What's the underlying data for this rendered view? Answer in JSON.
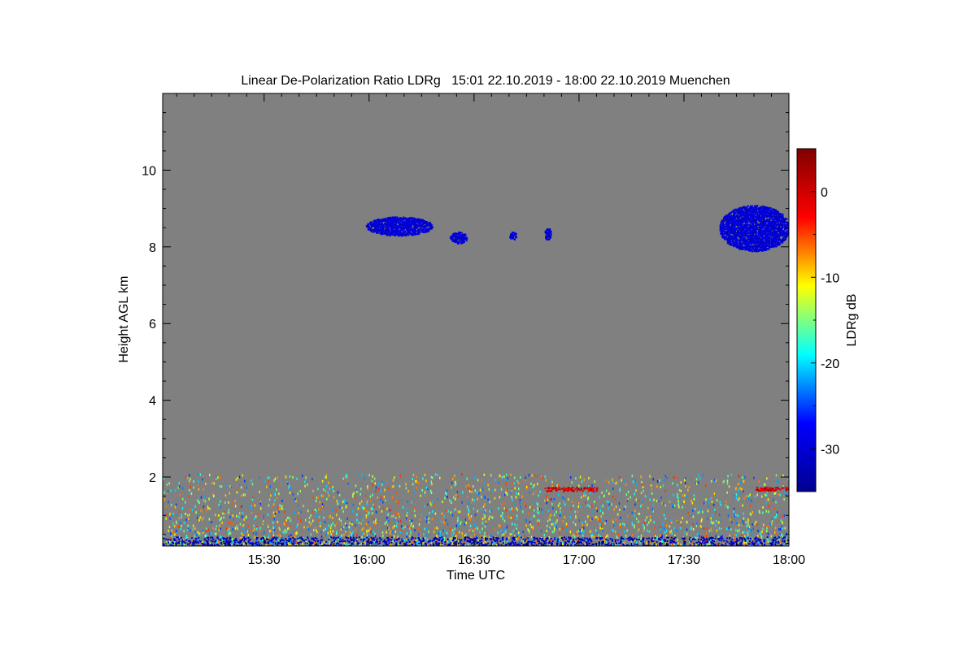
{
  "chart_data": {
    "type": "heatmap",
    "title": "Linear De-Polarization Ratio LDRg   15:01 22.10.2019 - 18:00 22.10.2019 Muenchen",
    "xlabel": "Time UTC",
    "ylabel": "Height AGL km",
    "colorbar_label": "LDRg dB",
    "xlim": [
      "15:01",
      "18:00"
    ],
    "ylim": [
      0.2,
      12
    ],
    "x_ticks": [
      "15:30",
      "16:00",
      "16:30",
      "17:00",
      "17:30",
      "18:00"
    ],
    "y_ticks": [
      2,
      4,
      6,
      8,
      10
    ],
    "colorbar_range": [
      -35,
      5
    ],
    "colorbar_ticks": [
      0,
      -10,
      -20,
      -30
    ],
    "colorscale": [
      "#00008f",
      "#0000ff",
      "#00ffff",
      "#ffff00",
      "#ff0000",
      "#800000"
    ],
    "background_color": "#808080",
    "features": [
      {
        "name": "cirrus cloud",
        "time_start": "15:59",
        "time_end": "16:18",
        "height_bottom": 8.3,
        "height_top": 8.8,
        "ldr_db": -30
      },
      {
        "name": "cirrus cloud",
        "time_start": "16:23",
        "time_end": "16:28",
        "height_bottom": 8.1,
        "height_top": 8.4,
        "ldr_db": -30
      },
      {
        "name": "cirrus cloud",
        "time_start": "16:40",
        "time_end": "16:42",
        "height_bottom": 8.2,
        "height_top": 8.4,
        "ldr_db": -30
      },
      {
        "name": "cirrus cloud",
        "time_start": "16:50",
        "time_end": "16:52",
        "height_bottom": 8.2,
        "height_top": 8.5,
        "ldr_db": -30
      },
      {
        "name": "cirrus cloud",
        "time_start": "17:40",
        "time_end": "18:00",
        "height_bottom": 7.9,
        "height_top": 9.1,
        "ldr_db": -30
      },
      {
        "name": "aerosol layer",
        "time_start": "15:01",
        "time_end": "18:00",
        "height_bottom": 0.2,
        "height_top": 2.1,
        "ldr_db": -15
      },
      {
        "name": "depolarizing layer",
        "time_start": "16:50",
        "time_end": "17:05",
        "height_bottom": 1.65,
        "height_top": 1.75,
        "ldr_db": 0
      },
      {
        "name": "depolarizing layer",
        "time_start": "17:50",
        "time_end": "18:00",
        "height_bottom": 1.65,
        "height_top": 1.75,
        "ldr_db": 0
      },
      {
        "name": "low depolarization surface layer",
        "time_start": "15:01",
        "time_end": "18:00",
        "height_bottom": 0.2,
        "height_top": 0.45,
        "ldr_db": -32
      }
    ]
  }
}
